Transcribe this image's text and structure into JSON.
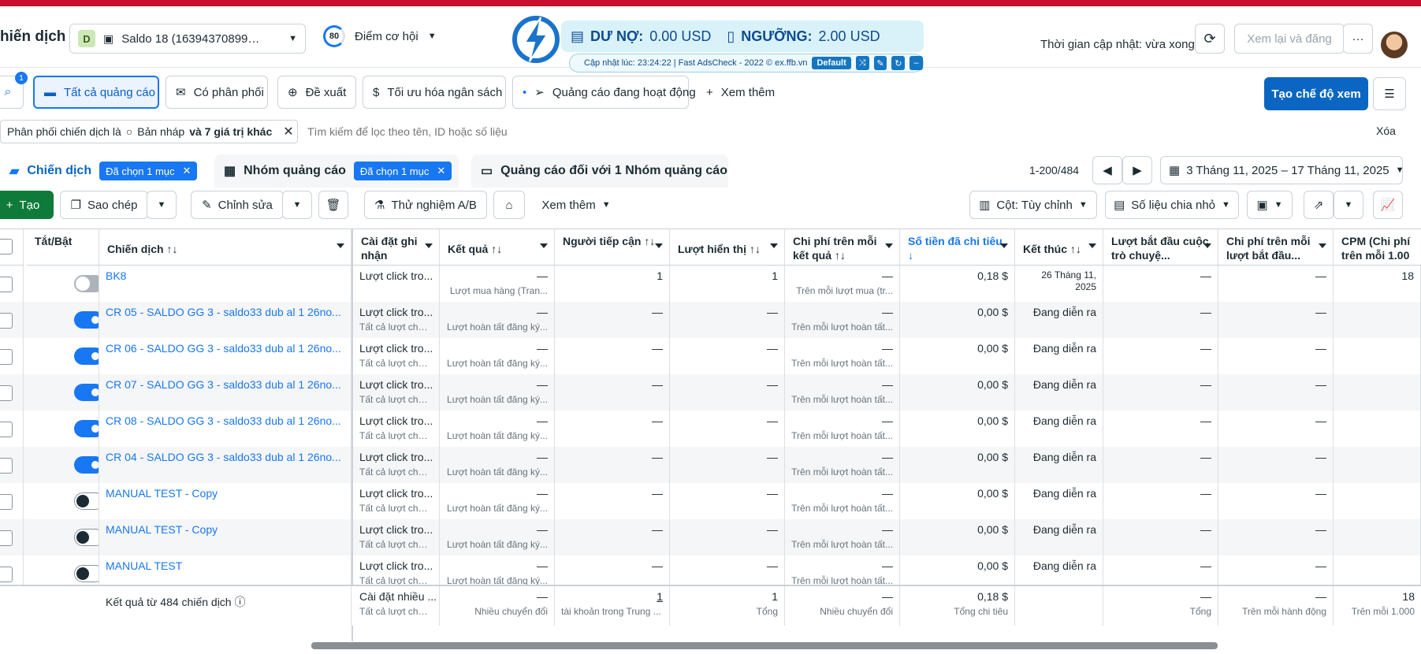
{
  "header": {
    "title": "hiến dịch",
    "account_badge": "D",
    "account_name": "Saldo 18 (163943708990...",
    "score_value": "80",
    "score_label": "Điểm cơ hội",
    "update_label": "Thời gian cập nhật: vừa xong",
    "review_button": "Xem lại và đăng"
  },
  "fast": {
    "debt_label": "DƯ NỢ:",
    "debt_value": "0.00 USD",
    "limit_label": "NGƯỠNG:",
    "limit_value": "2.00 USD",
    "updated": "Cập nhật lúc: 23:24:22 | Fast AdsCheck - 2022 © ex.ffb.vn",
    "preset": "Default"
  },
  "tabs": {
    "search_badge": "1",
    "items": [
      "Tất cả quảng cáo",
      "Có phân phối",
      "Đề xuất",
      "Tối ưu hóa ngân sách",
      "Quảng cáo đang hoạt động"
    ],
    "more": "Xem thêm",
    "create_view": "Tạo chế độ xem"
  },
  "filter": {
    "chip_prefix": "Phân phối chiến dịch là",
    "chip_value": "Bản nháp",
    "chip_suffix": "và 7 giá trị khác",
    "placeholder": "Tìm kiếm để lọc theo tên, ID hoặc số liệu",
    "clear": "Xóa"
  },
  "levels": {
    "campaigns": "Chiến dịch",
    "campaigns_sel": "Đã chọn 1 mục",
    "adsets": "Nhóm quảng cáo",
    "adsets_sel": "Đã chọn 1 mục",
    "ads": "Quảng cáo đối với 1 Nhóm quảng cáo",
    "pagination": "1-200/484",
    "date_range": "3 Tháng 11, 2025 – 17 Tháng 11, 2025"
  },
  "toolbar": {
    "create": "Tạo",
    "duplicate": "Sao chép",
    "edit": "Chỉnh sửa",
    "ab_test": "Thử nghiệm A/B",
    "more": "Xem thêm",
    "columns": "Cột: Tùy chỉnh",
    "breakdown": "Số liệu chia nhỏ"
  },
  "columns": [
    "Tắt/Bật",
    "Chiến dịch",
    "Cài đặt ghi nhận",
    "Kết quả",
    "Người tiếp cận",
    "Lượt hiển thị",
    "Chi phí trên mỗi kết quả",
    "Số tiền đã chi tiêu",
    "Kết thúc",
    "Lượt bắt đầu cuộc trò chuyệ...",
    "Chi phí trên mỗi lượt bắt đầu...",
    "CPM (Chi phí trên mỗi 1.00"
  ],
  "rows": [
    {
      "toggle": "off",
      "name": "BK8",
      "attr": "Lượt click tro...",
      "attr_sub": "",
      "result": "—",
      "result_sub": "Lượt mua hàng (Tran...",
      "reach": "1",
      "impr": "1",
      "cpr": "—",
      "cpr_sub": "Trên mỗi lượt mua (tr...",
      "spent": "0,18 $",
      "end": "26 Tháng 11, 2025",
      "conv": "—",
      "cpc": "—",
      "cpm": "18"
    },
    {
      "toggle": "on",
      "name": "CR 05 - SALDO GG 3 - saldo33 dub al 1 26no...",
      "attr": "Lượt click tro...",
      "attr_sub": "Tất cả lượt chuyể...",
      "result": "—",
      "result_sub": "Lượt hoàn tất đăng ký...",
      "reach": "—",
      "impr": "—",
      "cpr": "—",
      "cpr_sub": "Trên mỗi lượt hoàn tất...",
      "spent": "0,00 $",
      "end": "Đang diễn ra",
      "conv": "—",
      "cpc": "—",
      "cpm": ""
    },
    {
      "toggle": "on",
      "name": "CR 06 - SALDO GG 3 - saldo33 dub al 1 26no...",
      "attr": "Lượt click tro...",
      "attr_sub": "Tất cả lượt chuyể...",
      "result": "—",
      "result_sub": "Lượt hoàn tất đăng ký...",
      "reach": "—",
      "impr": "—",
      "cpr": "—",
      "cpr_sub": "Trên mỗi lượt hoàn tất...",
      "spent": "0,00 $",
      "end": "Đang diễn ra",
      "conv": "—",
      "cpc": "—",
      "cpm": ""
    },
    {
      "toggle": "on",
      "name": "CR 07 - SALDO GG 3 - saldo33 dub al 1 26no...",
      "attr": "Lượt click tro...",
      "attr_sub": "Tất cả lượt chuyể...",
      "result": "—",
      "result_sub": "Lượt hoàn tất đăng ký...",
      "reach": "—",
      "impr": "—",
      "cpr": "—",
      "cpr_sub": "Trên mỗi lượt hoàn tất...",
      "spent": "0,00 $",
      "end": "Đang diễn ra",
      "conv": "—",
      "cpc": "—",
      "cpm": ""
    },
    {
      "toggle": "on",
      "name": "CR 08 - SALDO GG 3 - saldo33 dub al 1 26no...",
      "attr": "Lượt click tro...",
      "attr_sub": "Tất cả lượt chuyể...",
      "result": "—",
      "result_sub": "Lượt hoàn tất đăng ký...",
      "reach": "—",
      "impr": "—",
      "cpr": "—",
      "cpr_sub": "Trên mỗi lượt hoàn tất...",
      "spent": "0,00 $",
      "end": "Đang diễn ra",
      "conv": "—",
      "cpc": "—",
      "cpm": ""
    },
    {
      "toggle": "on",
      "name": "CR 04 - SALDO GG 3 - saldo33 dub al 1 26no...",
      "attr": "Lượt click tro...",
      "attr_sub": "Tất cả lượt chuyể...",
      "result": "—",
      "result_sub": "Lượt hoàn tất đăng ký...",
      "reach": "—",
      "impr": "—",
      "cpr": "—",
      "cpr_sub": "Trên mỗi lượt hoàn tất...",
      "spent": "0,00 $",
      "end": "Đang diễn ra",
      "conv": "—",
      "cpc": "—",
      "cpm": ""
    },
    {
      "toggle": "dark",
      "name": "MANUAL TEST - Copy",
      "attr": "Lượt click tro...",
      "attr_sub": "Tất cả lượt chuyể...",
      "result": "—",
      "result_sub": "Lượt hoàn tất đăng ký...",
      "reach": "—",
      "impr": "—",
      "cpr": "—",
      "cpr_sub": "Trên mỗi lượt hoàn tất...",
      "spent": "0,00 $",
      "end": "Đang diễn ra",
      "conv": "—",
      "cpc": "—",
      "cpm": ""
    },
    {
      "toggle": "dark",
      "name": "MANUAL TEST - Copy",
      "attr": "Lượt click tro...",
      "attr_sub": "Tất cả lượt chuyể...",
      "result": "—",
      "result_sub": "Lượt hoàn tất đăng ký...",
      "reach": "—",
      "impr": "—",
      "cpr": "—",
      "cpr_sub": "Trên mỗi lượt hoàn tất...",
      "spent": "0,00 $",
      "end": "Đang diễn ra",
      "conv": "—",
      "cpc": "—",
      "cpm": ""
    },
    {
      "toggle": "dark",
      "name": "MANUAL TEST",
      "attr": "Lượt click tro...",
      "attr_sub": "Tất cả lượt chuyể...",
      "result": "—",
      "result_sub": "Lượt hoàn tất đăng ký...",
      "reach": "—",
      "impr": "—",
      "cpr": "—",
      "cpr_sub": "Trên mỗi lượt hoàn tất...",
      "spent": "0,00 $",
      "end": "Đang diễn ra",
      "conv": "—",
      "cpc": "—",
      "cpm": ""
    }
  ],
  "footer": {
    "label": "Kết quả từ 484 chiến dịch",
    "attr": "Cài đặt nhiều ...",
    "attr_sub": "Tất cả lượt chuyể...",
    "result": "—",
    "result_sub": "Nhiều chuyển đổi",
    "reach": "1",
    "reach_sub": "tài khoản trong Trung ...",
    "impr": "1",
    "impr_sub": "Tổng",
    "cpr": "—",
    "cpr_sub": "Nhiều chuyển đổi",
    "spent": "0,18 $",
    "spent_sub": "Tổng chi tiêu",
    "conv": "—",
    "conv_sub": "Tổng",
    "cpc": "—",
    "cpc_sub": "Trên mỗi hành động",
    "cpm": "18",
    "cpm_sub": "Trên mỗi 1.000"
  }
}
